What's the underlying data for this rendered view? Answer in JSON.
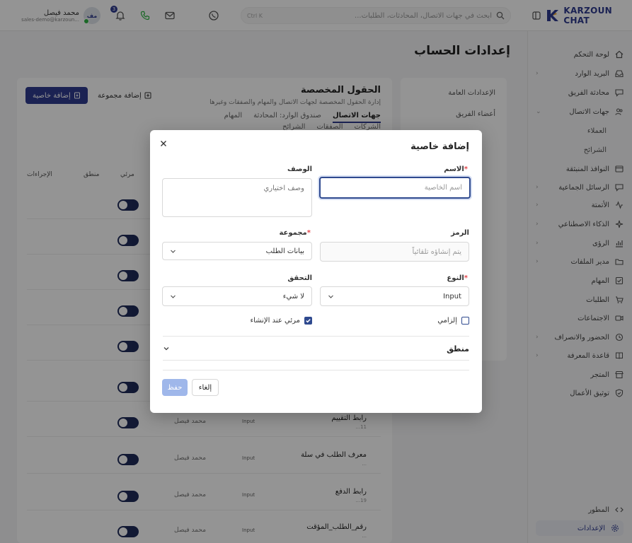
{
  "brand": {
    "name": "KARZOUN CHAT"
  },
  "topbar": {
    "search_placeholder": "ابحث في جهات الاتصال، المحادثات، الطلبات...",
    "search_shortcut": "Ctrl K",
    "notifications_count": "3",
    "user_name": "محمد فيصل",
    "user_email": "sales-demo@karzoun...",
    "avatar_initials": "مف"
  },
  "sidebar": {
    "items": [
      {
        "label": "لوحة التحكم",
        "icon": "dashboard-icon"
      },
      {
        "label": "البريد الوارد",
        "icon": "inbox-icon"
      },
      {
        "label": "محادثة الفريق",
        "icon": "team-chat-icon"
      },
      {
        "label": "جهات الاتصال",
        "icon": "contacts-icon"
      },
      {
        "label": "الرسائل الجماعية",
        "icon": "broadcast-icon"
      },
      {
        "label": "الأتمتة",
        "icon": "automation-icon"
      },
      {
        "label": "الذكاء الاصطناعي",
        "icon": "ai-icon"
      },
      {
        "label": "الرؤى",
        "icon": "insights-icon"
      },
      {
        "label": "مدير الملفات",
        "icon": "folder-icon"
      },
      {
        "label": "المهام",
        "icon": "tasks-icon"
      },
      {
        "label": "الطلبات",
        "icon": "cart-icon"
      },
      {
        "label": "الاجتماعات",
        "icon": "meetings-icon"
      },
      {
        "label": "الحضور والانصراف",
        "icon": "attendance-icon"
      },
      {
        "label": "قاعدة المعرفة",
        "icon": "knowledge-icon"
      },
      {
        "label": "المتجر",
        "icon": "store-icon"
      },
      {
        "label": "توثيق الأعمال",
        "icon": "verify-icon"
      }
    ],
    "sub_items": [
      "العملاء",
      "الشرائح"
    ],
    "floating_windows": "النوافذ المنبثقة",
    "developer": "المطور",
    "settings": "الإعدادات"
  },
  "page": {
    "title": "إعدادات الحساب"
  },
  "settings_nav": {
    "items": [
      "الإعدادات العامة",
      "أعضاء الفريق"
    ]
  },
  "content": {
    "title": "الحقول المخصصة",
    "subtitle": "إدارة الحقول المخصصة لجهات الاتصال والمهام والصفقات وغيرها",
    "add_property": "إضافة خاصية",
    "add_group": "إضافة مجموعة",
    "tabs_row1": [
      "جهات الاتصال",
      "صندوق الوارد: المحادثة",
      "المهام"
    ],
    "tabs_row2": [
      "الشركات",
      "الصفقات",
      "الشرائح"
    ],
    "active_tab": "جهات الاتصال",
    "columns": {
      "actions": "الإجراءات",
      "logic": "منطق",
      "visible": "مرئي"
    },
    "rows": [
      {
        "name": "رابط التقييم",
        "type": "Input",
        "creator": "محمد فيصل",
        "date": "11..."
      },
      {
        "name": "معرف الطلب في سلة",
        "type": "Input",
        "creator": "محمد فيصل",
        "date": "..."
      },
      {
        "name": "رابط الدفع",
        "type": "Input",
        "creator": "محمد فيصل",
        "date": "19..."
      },
      {
        "name": "رقم_الطلب_المؤقت",
        "type": "Input",
        "creator": "محمد فيصل",
        "date": "..."
      }
    ]
  },
  "modal": {
    "title": "إضافة خاصية",
    "name_label": "الاسم",
    "name_placeholder": "اسم الخاصية",
    "description_label": "الوصف",
    "description_placeholder": "وصف اختياري",
    "code_label": "الرمز",
    "code_placeholder": "يتم إنشاؤه تلقائياً",
    "group_label": "مجموعة",
    "group_value": "بيانات الطلب",
    "type_label": "النوع",
    "type_value": "Input",
    "validation_label": "التحقق",
    "validation_value": "لا شيء",
    "required_label": "إلزامي",
    "required_checked": false,
    "visible_on_create_label": "مرئي عند الإنشاء",
    "visible_on_create_checked": true,
    "logic_label": "منطق",
    "cancel_label": "إلغاء",
    "save_label": "حفظ"
  },
  "colors": {
    "brand": "#2f3b8f",
    "accent": "#2f4a8f",
    "required": "#e5484d",
    "save_disabled": "#9fb7ea"
  }
}
